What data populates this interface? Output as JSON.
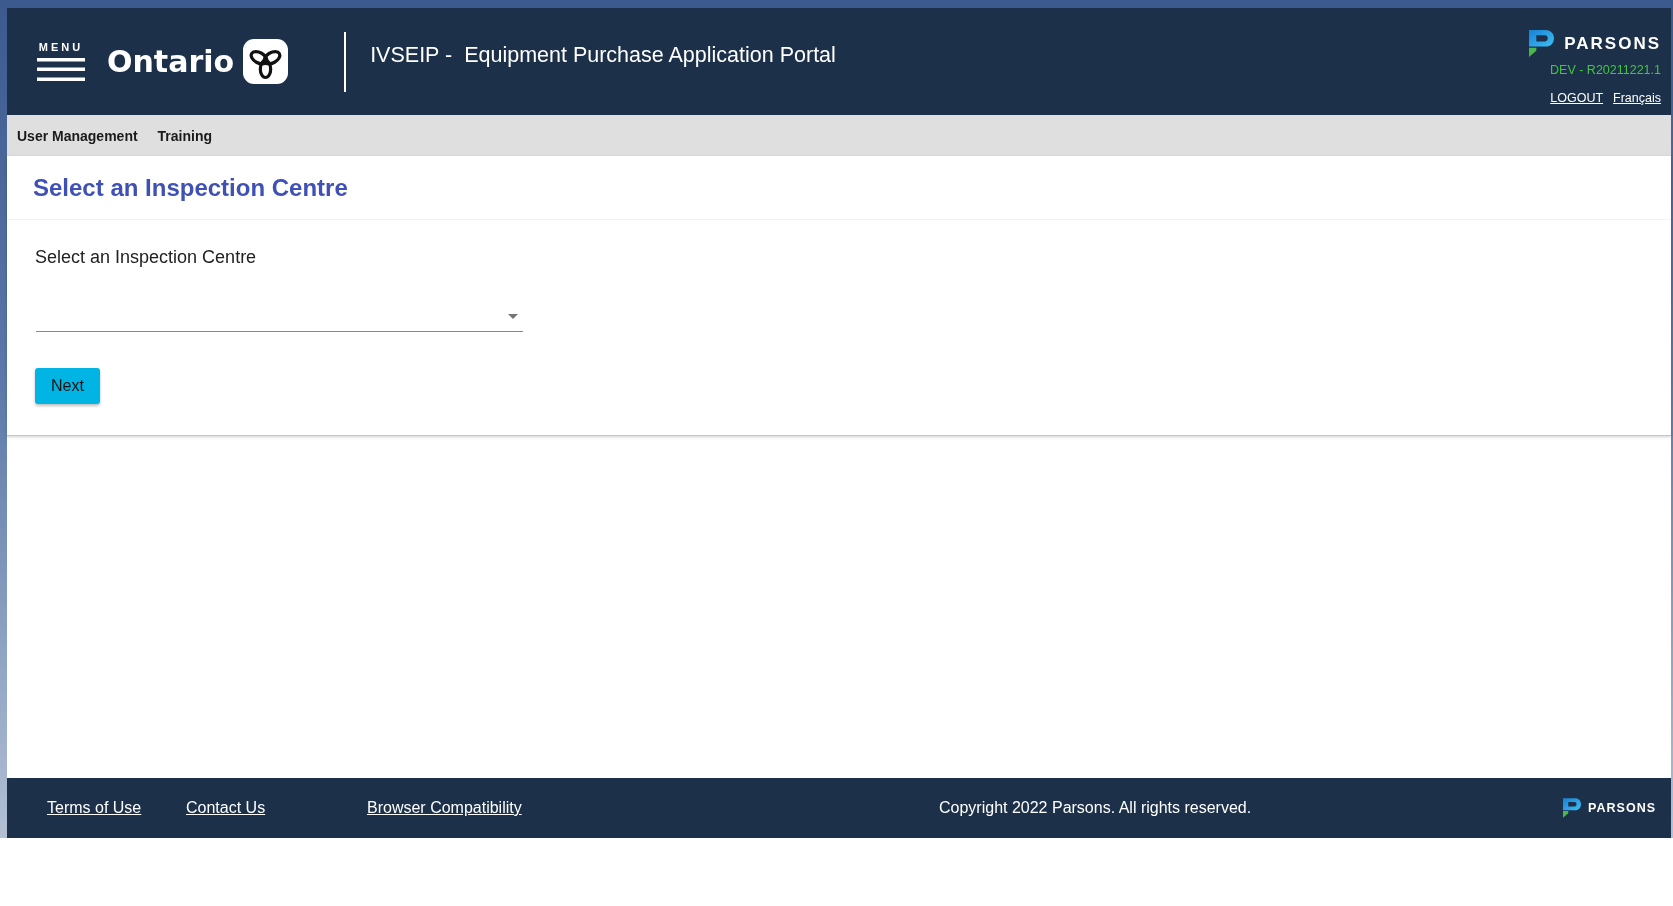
{
  "header": {
    "menu_label": "MENU",
    "brand": "Ontario",
    "portal_title": "IVSEIP -  Equipment Purchase Application Portal",
    "partner_name": "PARSONS",
    "version": "DEV - R20211221.1",
    "links": [
      "LOGOUT",
      "Français"
    ]
  },
  "nav": {
    "items": [
      "User Management",
      "Training"
    ]
  },
  "page": {
    "title": "Select an Inspection Centre",
    "field_label": "Select an Inspection Centre",
    "button": "Next"
  },
  "footer": {
    "links": [
      "Terms of Use",
      "Contact Us",
      "Browser Compatibility"
    ],
    "copyright": "Copyright 2022 Parsons. All rights reserved.",
    "partner_name": "PARSONS"
  }
}
